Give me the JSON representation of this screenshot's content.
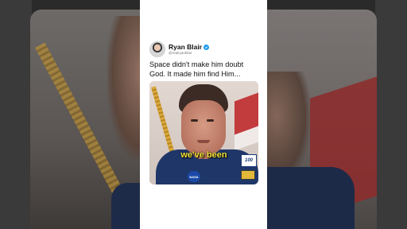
{
  "post": {
    "author_name": "Ryan Blair",
    "author_handle": "@realryanblair",
    "text": "Space didn't make him doubt God. It made him find Him...",
    "caption": "we've been"
  },
  "photo": {
    "nasa_label": "NASA",
    "patch_label": "100"
  },
  "colors": {
    "verified": "#1d9bf0",
    "caption": "#f4e33a",
    "card": "#ffffff"
  }
}
